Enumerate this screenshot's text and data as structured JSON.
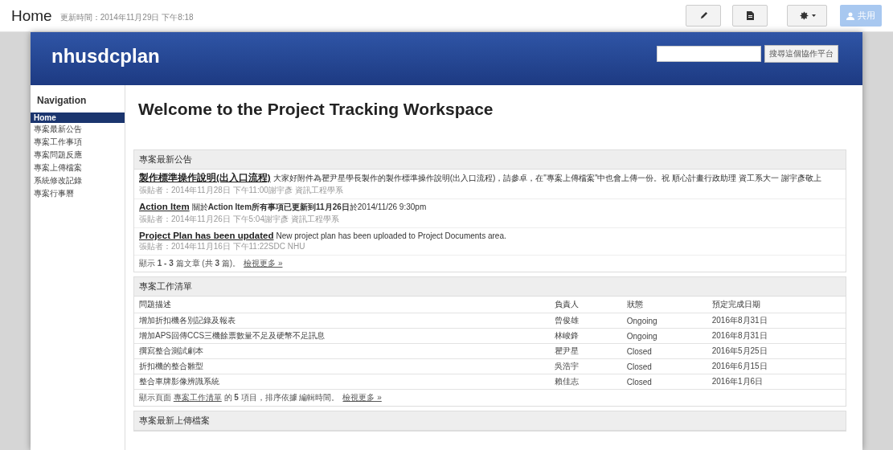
{
  "page_header": {
    "title": "Home",
    "updated": "更新時間：2014年11月29日 下午8:18",
    "share_label": "共用"
  },
  "site": {
    "title": "nhusdcplan",
    "search_button": "搜尋這個協作平台"
  },
  "navigation": {
    "heading": "Navigation",
    "items": [
      {
        "label": "Home",
        "selected": true
      },
      {
        "label": "專案最新公告",
        "selected": false
      },
      {
        "label": "專案工作事項",
        "selected": false
      },
      {
        "label": "專案問題反應",
        "selected": false
      },
      {
        "label": "專案上傳檔案",
        "selected": false
      },
      {
        "label": "系統修改記錄",
        "selected": false
      },
      {
        "label": "專案行事曆",
        "selected": false
      }
    ]
  },
  "welcome": "Welcome to the Project Tracking Workspace",
  "announcements": {
    "heading": "專案最新公告",
    "posts": [
      {
        "title": "製作標準操作說明(出入口流程)",
        "body": "大家好附件為瞿尹星學長製作的製作標準操作說明(出入口流程)，請參卓，在\"專案上傳檔案\"中也會上傳一份。祝 順心計畫行政助理 資工系大一 謝宇彥敬上",
        "meta": "張貼者：2014年11月28日 下午11:00謝宇彥 資訊工程學系"
      },
      {
        "title": "Action Item",
        "body": "關於**Action Item所有事項已更新到11月26日**於2014/11/26 9:30pm",
        "meta": "張貼者：2014年11月26日 下午5:04謝宇彥 資訊工程學系"
      },
      {
        "title": "Project Plan has been updated",
        "body": "New project plan has been uploaded to Project Documents area.",
        "meta": "張貼者：2014年11月16日 下午11:22SDC NHU"
      }
    ],
    "footer": "顯示 **1 - 3** 篇文章 (共 **3** 篇)。",
    "more_link": "檢視更多 »"
  },
  "tasks": {
    "heading": "專案工作清單",
    "columns": [
      "問題描述",
      "負責人",
      "狀態",
      "預定完成日期"
    ],
    "rows": [
      [
        "增加折扣機各別記錄及報表",
        "曾俊雄",
        "Ongoing",
        "2016年8月31日"
      ],
      [
        "增加APS回傳CCS三機餘票數量不足及硬幣不足訊息",
        "林峻鋒",
        "Ongoing",
        "2016年8月31日"
      ],
      [
        "撰寫整合測試劇本",
        "瞿尹星",
        "Closed",
        "2016年5月25日"
      ],
      [
        "折扣機的整合雛型",
        "吳浩宇",
        "Closed",
        "2016年6月15日"
      ],
      [
        "整合車牌影像辨識系統",
        "賴佳志",
        "Closed",
        "2016年1月6日"
      ]
    ],
    "footer_before": "顯示頁面",
    "footer_link": "專案工作清單",
    "footer_after": "的 **5** 項目，排序依據 編輯時間。",
    "more_link": "檢視更多 »"
  },
  "uploads": {
    "heading": "專案最新上傳檔案"
  }
}
